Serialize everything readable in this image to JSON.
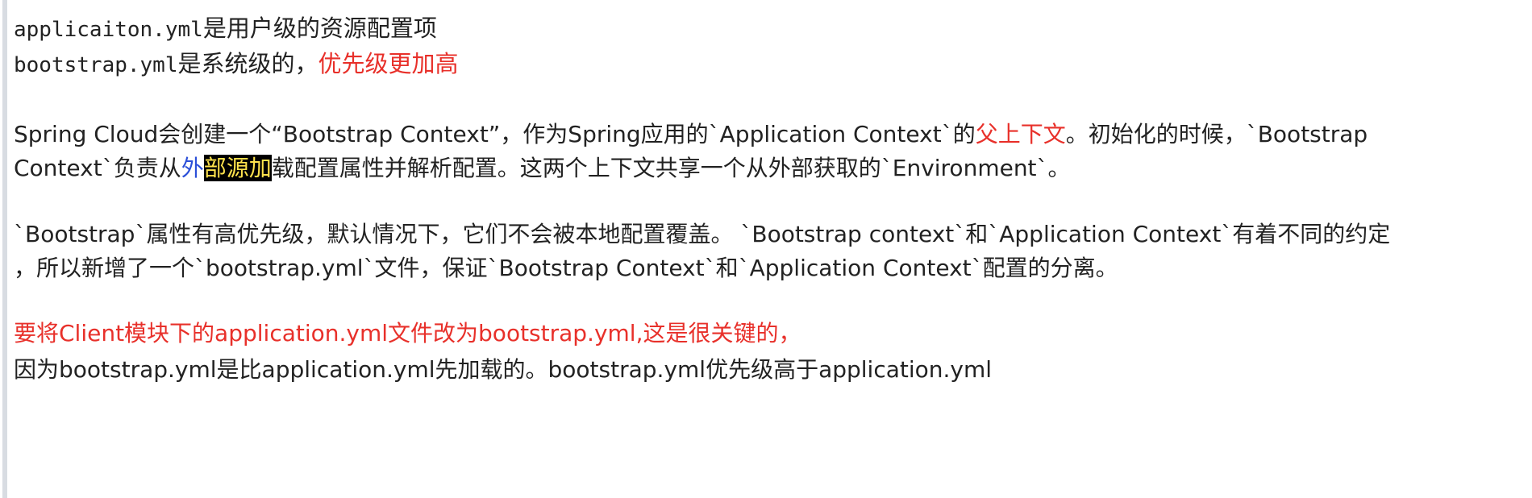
{
  "note": {
    "line1": {
      "code": "applicaiton.yml",
      "text": "是用户级的资源配置项"
    },
    "line2": {
      "code": "bootstrap.yml",
      "text": "是系统级的，",
      "emphasis": "优先级更加高"
    },
    "para1": {
      "row1_a": "Spring Cloud会创建一个“Bootstrap Context”，作为Spring应用的`Application Context`的",
      "row1_red": "父上下文",
      "row1_b": "。初始化的时候，`Bootstrap",
      "row2_a": "Context`负责从",
      "row2_blue": "外",
      "row2_hl": "部源",
      "row2_hl2": "加",
      "row2_b": "载配置属性并解析配置。这两个上下文共享一个从外部获取的`Environment`。"
    },
    "para2": {
      "row1": "`Bootstrap`属性有高优先级，默认情况下，它们不会被本地配置覆盖。 `Bootstrap context`和`Application Context`有着不同的约定",
      "row2": "，所以新增了一个`bootstrap.yml`文件，保证`Bootstrap Context`和`Application Context`配置的分离。"
    },
    "red_line": "要将Client模块下的application.yml文件改为bootstrap.yml,这是很关键的，",
    "last_line": "因为bootstrap.yml是比application.yml先加载的。bootstrap.yml优先级高于application.yml"
  },
  "colors": {
    "text": "#222222",
    "emphasis_red": "#e8302a",
    "link_blue": "#2b4fd8",
    "highlight_bg": "#000000",
    "highlight_fg": "#ffe34d"
  }
}
